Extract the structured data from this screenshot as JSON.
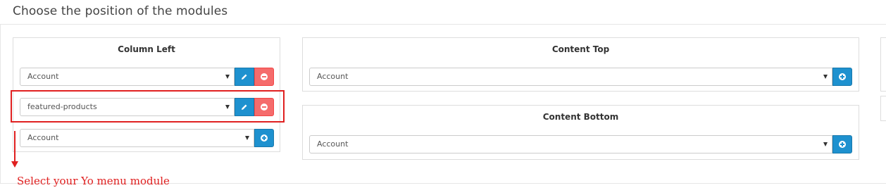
{
  "page": {
    "title": "Choose the position of the modules"
  },
  "column_left": {
    "heading": "Column Left",
    "rows": [
      {
        "value": "Account"
      },
      {
        "value": "featured-products"
      },
      {
        "value": "Account"
      }
    ]
  },
  "content_top": {
    "heading": "Content Top",
    "select_value": "Account"
  },
  "content_bottom": {
    "heading": "Content Bottom",
    "select_value": "Account"
  },
  "annotation": {
    "text": "Select your Yo menu module"
  },
  "colors": {
    "primary": "#1e91cf",
    "danger": "#f56b6b",
    "annotation": "#e02020"
  }
}
